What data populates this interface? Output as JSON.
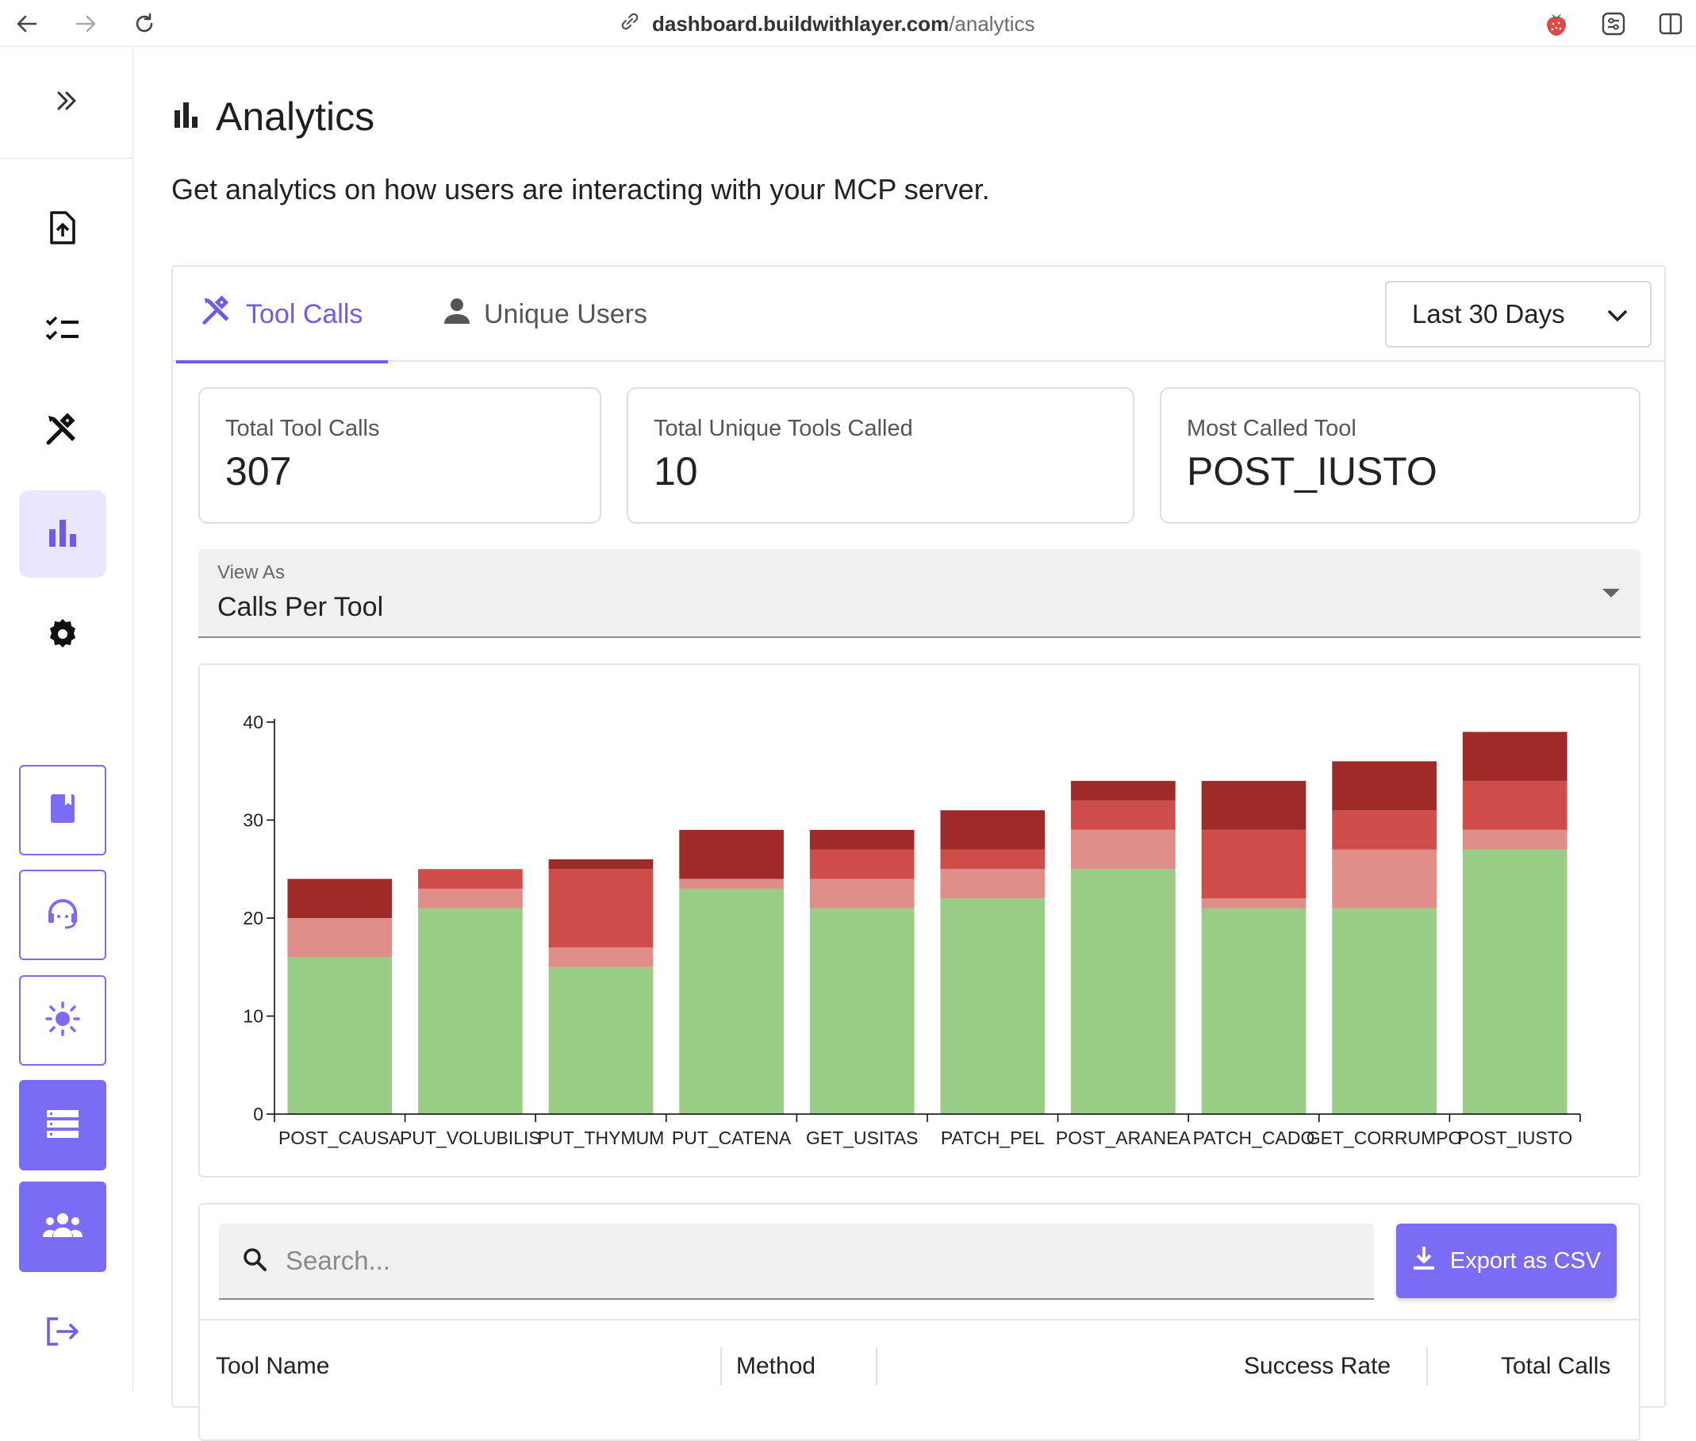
{
  "browser": {
    "url_host": "dashboard.buildwithlayer.com",
    "url_path": "/analytics"
  },
  "sidebar": {
    "items": [
      {
        "icon": "collapse-chevrons-icon"
      },
      {
        "icon": "file-upload-icon"
      },
      {
        "icon": "checklist-icon"
      },
      {
        "icon": "tools-icon"
      },
      {
        "icon": "analytics-bar-icon",
        "active": true
      },
      {
        "icon": "gear-icon"
      }
    ],
    "cards": [
      {
        "icon": "book-icon"
      },
      {
        "icon": "support-headset-icon"
      },
      {
        "icon": "sun-icon"
      },
      {
        "icon": "list-icon"
      },
      {
        "icon": "users-icon"
      }
    ],
    "logout_icon": "logout-icon"
  },
  "page": {
    "title": "Analytics",
    "subtitle": "Get analytics on how users are interacting with your MCP server."
  },
  "tabs": [
    {
      "label": "Tool Calls",
      "icon": "tools-icon",
      "active": true
    },
    {
      "label": "Unique Users",
      "icon": "person-icon",
      "active": false
    }
  ],
  "range": {
    "selected": "Last 30 Days"
  },
  "stats": [
    {
      "label": "Total Tool Calls",
      "value": "307"
    },
    {
      "label": "Total Unique Tools Called",
      "value": "10"
    },
    {
      "label": "Most Called Tool",
      "value": "POST_IUSTO"
    }
  ],
  "view_as": {
    "label": "View As",
    "value": "Calls Per Tool"
  },
  "colors": {
    "accent": "#7b6cf6",
    "tab_active": "#6c5ce7",
    "success": "#99cc85",
    "seg2": "#de8e87",
    "seg3": "#cf4d48",
    "seg4": "#9e2b27"
  },
  "chart_data": {
    "type": "bar",
    "stacked": true,
    "categories": [
      "POST_CAUSA",
      "PUT_VOLUBILIS",
      "PUT_THYMUM",
      "PUT_CATENA",
      "GET_USITAS",
      "PATCH_PEL",
      "POST_ARANEA",
      "PATCH_CADO",
      "GET_CORRUMPO",
      "POST_IUSTO"
    ],
    "series": [
      {
        "color": "#99cc85",
        "values": [
          16,
          21,
          15,
          23,
          21,
          22,
          25,
          21,
          21,
          27
        ]
      },
      {
        "color": "#de8e87",
        "values": [
          4,
          2,
          2,
          1,
          3,
          3,
          4,
          1,
          6,
          2
        ]
      },
      {
        "color": "#cf4d48",
        "values": [
          0,
          2,
          8,
          0,
          3,
          2,
          3,
          7,
          4,
          5
        ]
      },
      {
        "color": "#9e2b27",
        "values": [
          4,
          0,
          1,
          5,
          2,
          4,
          2,
          5,
          5,
          5
        ]
      }
    ],
    "ylim": [
      0,
      40
    ],
    "yticks": [
      0,
      10,
      20,
      30,
      40
    ],
    "grid": false
  },
  "table": {
    "search_placeholder": "Search...",
    "export_label": "Export as CSV",
    "columns": [
      "Tool Name",
      "Method",
      "Success Rate",
      "Total Calls"
    ]
  }
}
